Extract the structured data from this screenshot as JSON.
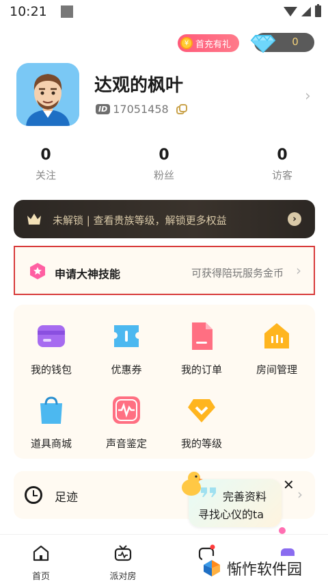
{
  "status_bar": {
    "time": "10:21"
  },
  "header": {
    "gift_badge": "首充有礼",
    "diamond_count": "0"
  },
  "profile": {
    "username": "达观的枫叶",
    "id_label": "ID",
    "id_number": "17051458",
    "chevron": "›"
  },
  "stats": [
    {
      "value": "0",
      "label": "关注"
    },
    {
      "value": "0",
      "label": "粉丝"
    },
    {
      "value": "0",
      "label": "访客"
    }
  ],
  "noble_banner": {
    "text": "未解锁 | 查看贵族等级，解锁更多权益",
    "arrow": "›"
  },
  "skill_row": {
    "title": "申请大神技能",
    "subtitle": "可获得陪玩服务金币",
    "chevron": "›"
  },
  "grid": [
    {
      "label": "我的钱包",
      "icon": "wallet-icon",
      "color": "#a66bf0"
    },
    {
      "label": "优惠券",
      "icon": "coupon-icon",
      "color": "#4cb8f0"
    },
    {
      "label": "我的订单",
      "icon": "order-icon",
      "color": "#ff6f82"
    },
    {
      "label": "房间管理",
      "icon": "room-icon",
      "color": "#ffb51f"
    },
    {
      "label": "道具商城",
      "icon": "shop-bag-icon",
      "color": "#4cb8f0"
    },
    {
      "label": "声音鉴定",
      "icon": "voice-icon",
      "color": "#ff6f82"
    },
    {
      "label": "我的等级",
      "icon": "level-icon",
      "color": "#ffb51f"
    }
  ],
  "footprint": {
    "label": "足迹",
    "chevron": "›"
  },
  "bubble": {
    "line1": "完善资料",
    "line2": "寻找心仪的ta",
    "close": "✕"
  },
  "tabbar": [
    {
      "label": "首页",
      "icon": "home-icon"
    },
    {
      "label": "派对房",
      "icon": "tv-icon"
    }
  ],
  "watermark": {
    "text": "惭怍软件园"
  }
}
